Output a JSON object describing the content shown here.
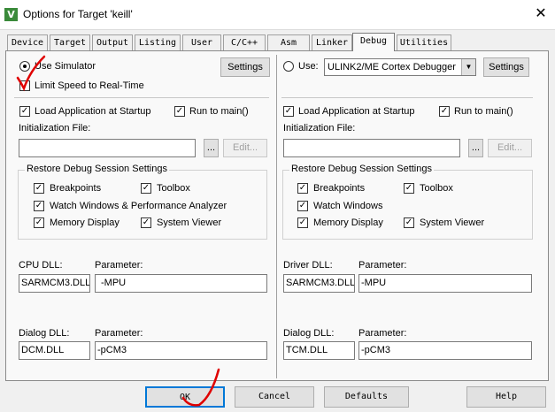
{
  "window": {
    "title": "Options for Target 'keill'",
    "app_icon_glyph": "V",
    "close_glyph": "✕"
  },
  "tabs": [
    "Device",
    "Target",
    "Output",
    "Listing",
    "User",
    "C/C++",
    "Asm",
    "Linker",
    "Debug",
    "Utilities"
  ],
  "active_tab": "Debug",
  "left": {
    "use_simulator_label": "Use Simulator",
    "limit_speed_label": "Limit Speed to Real-Time",
    "settings_label": "Settings",
    "load_app_label": "Load Application at Startup",
    "run_to_main_label": "Run to main()",
    "init_file_label": "Initialization File:",
    "browse_label": "...",
    "edit_label": "Edit...",
    "restore_group_title": "Restore Debug Session Settings",
    "breakpoints_label": "Breakpoints",
    "toolbox_label": "Toolbox",
    "watch_label": "Watch Windows & Performance Analyzer",
    "memory_label": "Memory Display",
    "sysviewer_label": "System Viewer",
    "cpu_dll_label": "CPU DLL:",
    "cpu_param_label": "Parameter:",
    "cpu_dll_value": "SARMCM3.DLL",
    "cpu_param_value": "-MPU",
    "dialog_dll_label": "Dialog DLL:",
    "dialog_param_label": "Parameter:",
    "dialog_dll_value": "DCM.DLL",
    "dialog_param_value": "-pCM3"
  },
  "right": {
    "use_label": "Use:",
    "debugger_value": "ULINK2/ME Cortex Debugger",
    "settings_label": "Settings",
    "load_app_label": "Load Application at Startup",
    "run_to_main_label": "Run to main()",
    "init_file_label": "Initialization File:",
    "browse_label": "...",
    "edit_label": "Edit...",
    "restore_group_title": "Restore Debug Session Settings",
    "breakpoints_label": "Breakpoints",
    "toolbox_label": "Toolbox",
    "watch_label": "Watch Windows",
    "memory_label": "Memory Display",
    "sysviewer_label": "System Viewer",
    "driver_dll_label": "Driver DLL:",
    "driver_param_label": "Parameter:",
    "driver_dll_value": "SARMCM3.DLL",
    "driver_param_value": "-MPU",
    "dialog_dll_label": "Dialog DLL:",
    "dialog_param_label": "Parameter:",
    "dialog_dll_value": "TCM.DLL",
    "dialog_param_value": "-pCM3"
  },
  "footer": {
    "ok_label": "OK",
    "cancel_label": "Cancel",
    "defaults_label": "Defaults",
    "help_label": "Help"
  },
  "colors": {
    "annotation_red": "#e00000",
    "app_icon": "#3a8a3a"
  }
}
